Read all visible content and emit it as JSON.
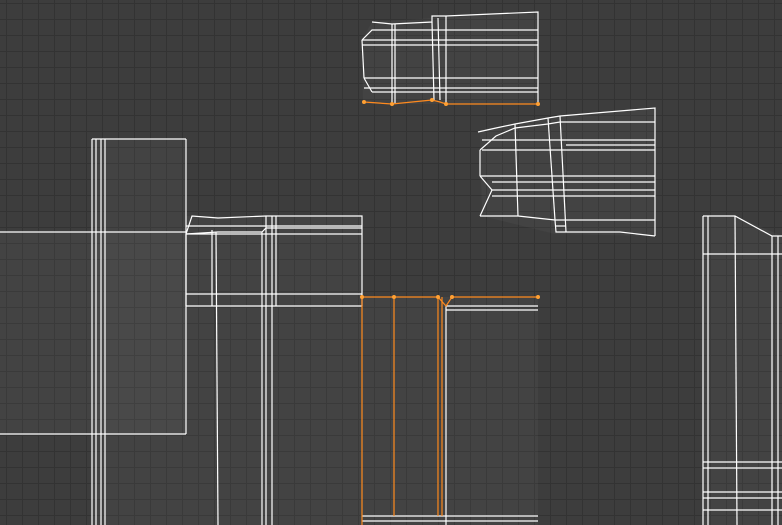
{
  "editor": {
    "type": "uv-editor",
    "background_color": "#3d3d3d",
    "grid_color": "#333333",
    "edge_color": "#ffffff",
    "selected_edge_color": "#ff8a1e",
    "selected_vertex_color": "#ffa033"
  },
  "uv_islands": [
    "island-top",
    "island-right-tilted",
    "island-large-left",
    "island-center",
    "island-selected-strip",
    "island-far-right"
  ]
}
